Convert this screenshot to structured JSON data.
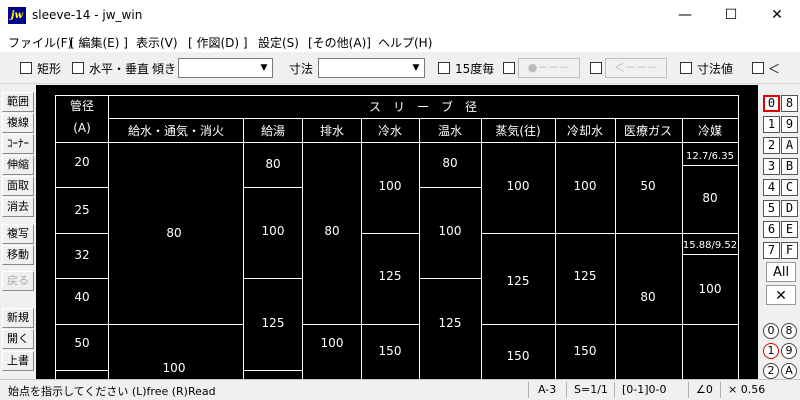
{
  "window": {
    "app_icon": "jw",
    "title": "sleeve-14 - jw_win",
    "minimize": "—",
    "maximize": "☐",
    "close": "✕"
  },
  "menu": [
    "ファイル(F)",
    "[ 編集(E) ]",
    "表示(V)",
    "[ 作図(D) ]",
    "設定(S)",
    "[その他(A)]",
    "ヘルプ(H)"
  ],
  "toolbar": {
    "rect": "矩形",
    "horizontal_vertical": "水平・垂直",
    "angle": "傾き",
    "angle_value": "",
    "dimension": "寸法",
    "dimension_value": "",
    "every15": "15度毎",
    "circle_btn": "●－－－",
    "arrow_btn": "＜－－－",
    "dim_value": "寸法値",
    "lt": "＜"
  },
  "left_tools": [
    "範囲",
    "複線",
    "ｺｰﾅｰ",
    "伸縮",
    "面取",
    "消去",
    "複写",
    "移動",
    "戻る",
    "新規",
    "開く",
    "上書"
  ],
  "drawing": {
    "header_pipe": "管径",
    "header_pipe_unit": "(A)",
    "header_sleeve": "ス　リ　ー　ブ　径",
    "columns": [
      "給水・通気・消火",
      "給湯",
      "排水",
      "冷水",
      "温水",
      "蒸気(往)",
      "冷却水",
      "医療ガス",
      "冷媒"
    ],
    "rows": [
      "20",
      "25",
      "32",
      "40",
      "50"
    ],
    "cells": {
      "water_supply_1": "80",
      "water_supply_2": "100",
      "hot_water_1": "80",
      "hot_water_2": "100",
      "hot_water_3": "125",
      "drain_1": "80",
      "drain_2": "100",
      "chilled_1": "100",
      "chilled_2": "125",
      "chilled_3": "150",
      "warm_1": "80",
      "warm_2": "100",
      "warm_3": "125",
      "steam_1": "100",
      "steam_2": "125",
      "steam_3": "150",
      "cooling_1": "100",
      "cooling_2": "125",
      "cooling_3": "150",
      "medical_1": "50",
      "medical_2": "80",
      "refrig_label_1": "12.7/6.35",
      "refrig_1": "80",
      "refrig_label_2": "15.88/9.52",
      "refrig_2": "100"
    }
  },
  "layers": {
    "pairs": [
      [
        "0",
        "8"
      ],
      [
        "1",
        "9"
      ],
      [
        "2",
        "A"
      ],
      [
        "3",
        "B"
      ],
      [
        "4",
        "C"
      ],
      [
        "5",
        "D"
      ],
      [
        "6",
        "E"
      ],
      [
        "7",
        "F"
      ]
    ],
    "all": "All",
    "cross": "✕",
    "groups": [
      [
        "0",
        "8"
      ],
      [
        "1",
        "9"
      ],
      [
        "2",
        "A"
      ]
    ]
  },
  "status": {
    "prompt": "始点を指示してください (L)free (R)Read",
    "paper": "A-3",
    "scale": "S=1/1",
    "layer": "[0-1]0-0",
    "angle": "∠0",
    "zoom": "× 0.56"
  }
}
